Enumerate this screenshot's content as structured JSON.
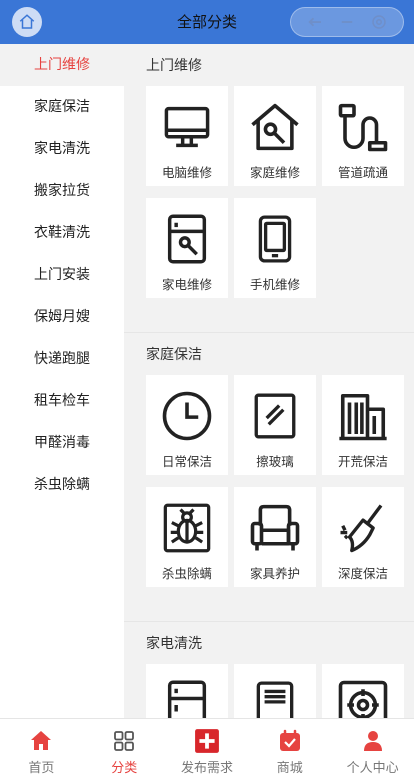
{
  "header": {
    "title": "全部分类",
    "home_icon": "home-icon",
    "capsule_icons": [
      "back-icon",
      "more-icon",
      "settings-icon"
    ]
  },
  "sidebar": {
    "items": [
      {
        "label": "上门维修",
        "active": true
      },
      {
        "label": "家庭保洁",
        "active": false
      },
      {
        "label": "家电清洗",
        "active": false
      },
      {
        "label": "搬家拉货",
        "active": false
      },
      {
        "label": "衣鞋清洗",
        "active": false
      },
      {
        "label": "上门安装",
        "active": false
      },
      {
        "label": "保姆月嫂",
        "active": false
      },
      {
        "label": "快递跑腿",
        "active": false
      },
      {
        "label": "租车检车",
        "active": false
      },
      {
        "label": "甲醛消毒",
        "active": false
      },
      {
        "label": "杀虫除螨",
        "active": false
      }
    ]
  },
  "sections": [
    {
      "title": "上门维修",
      "items": [
        {
          "label": "电脑维修",
          "icon": "monitor-icon"
        },
        {
          "label": "家庭维修",
          "icon": "house-wrench-icon"
        },
        {
          "label": "管道疏通",
          "icon": "pipe-icon"
        },
        {
          "label": "家电维修",
          "icon": "fridge-wrench-icon"
        },
        {
          "label": "手机维修",
          "icon": "phone-icon"
        }
      ]
    },
    {
      "title": "家庭保洁",
      "items": [
        {
          "label": "日常保洁",
          "icon": "clock-icon"
        },
        {
          "label": "擦玻璃",
          "icon": "glass-icon"
        },
        {
          "label": "开荒保洁",
          "icon": "building-icon"
        },
        {
          "label": "杀虫除螨",
          "icon": "bug-icon"
        },
        {
          "label": "家具养护",
          "icon": "sofa-icon"
        },
        {
          "label": "深度保洁",
          "icon": "broom-icon"
        }
      ]
    },
    {
      "title": "家电清洗",
      "items": [
        {
          "label": "",
          "icon": "fridge-icon"
        },
        {
          "label": "",
          "icon": "air-conditioner-icon"
        },
        {
          "label": "",
          "icon": "range-hood-icon"
        }
      ]
    }
  ],
  "tabbar": {
    "items": [
      {
        "label": "首页",
        "icon": "home-icon",
        "active": false
      },
      {
        "label": "分类",
        "icon": "category-icon",
        "active": true
      },
      {
        "label": "发布需求",
        "icon": "plus-icon",
        "active": false
      },
      {
        "label": "商城",
        "icon": "shop-icon",
        "active": false
      },
      {
        "label": "个人中心",
        "icon": "user-icon",
        "active": false
      }
    ]
  },
  "colors": {
    "header_bg": "#3a76d6",
    "accent": "#e64340",
    "icon_stroke": "#222222"
  }
}
